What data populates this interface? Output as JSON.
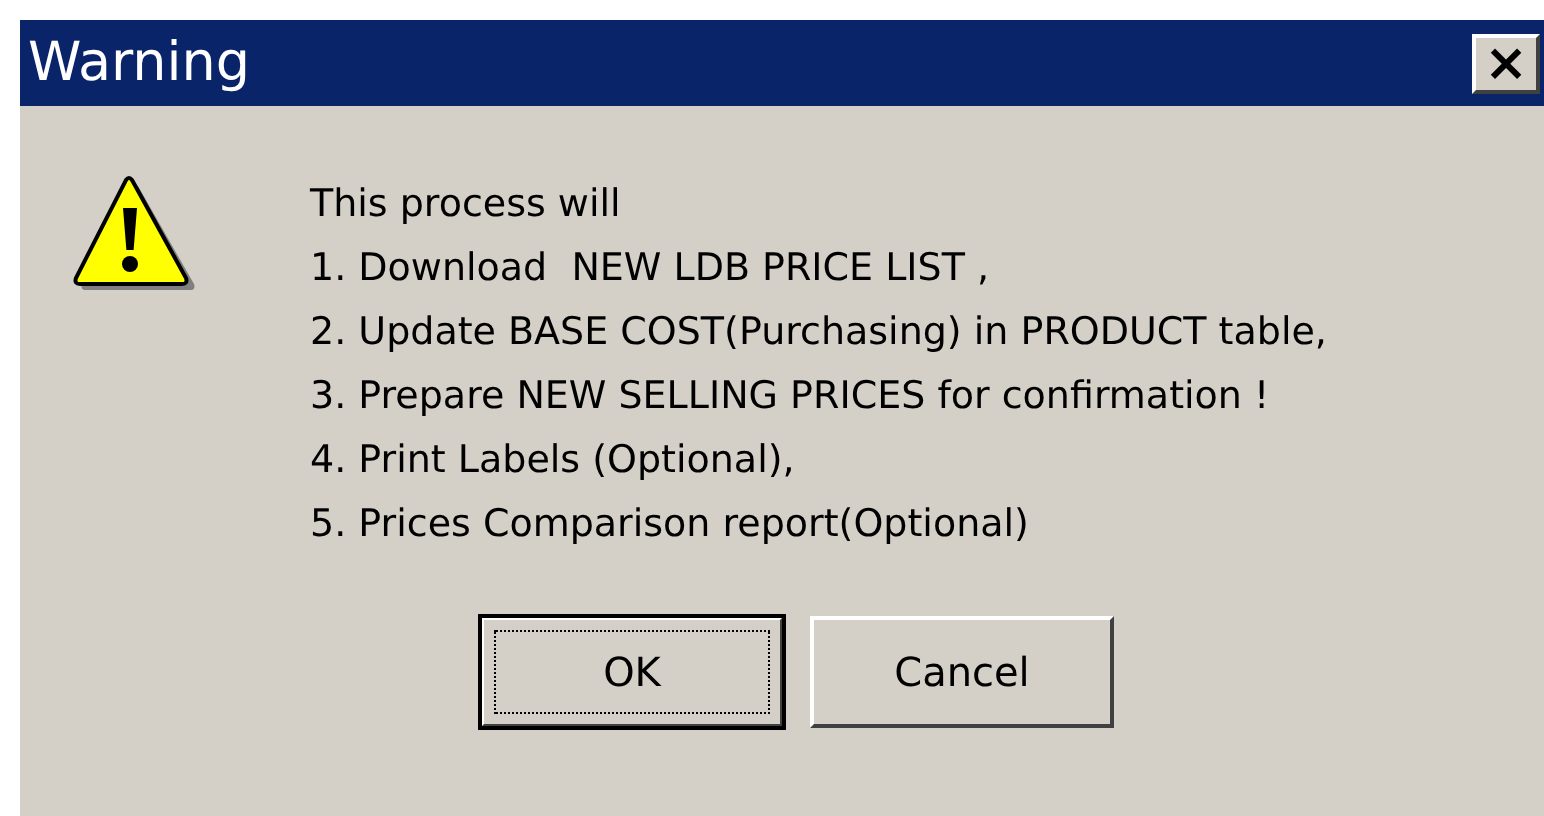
{
  "window": {
    "title": "Warning",
    "close_label": "×"
  },
  "message": {
    "lines": [
      "This process will",
      "1. Download  NEW LDB PRICE LIST ,",
      "2. Update BASE COST(Purchasing) in PRODUCT table,",
      "3. Prepare NEW SELLING PRICES for confirmation !",
      "4. Print Labels (Optional),",
      "5. Prices Comparison report(Optional)"
    ]
  },
  "buttons": [
    {
      "label": "OK",
      "focused": true
    },
    {
      "label": "Cancel",
      "focused": false
    }
  ]
}
